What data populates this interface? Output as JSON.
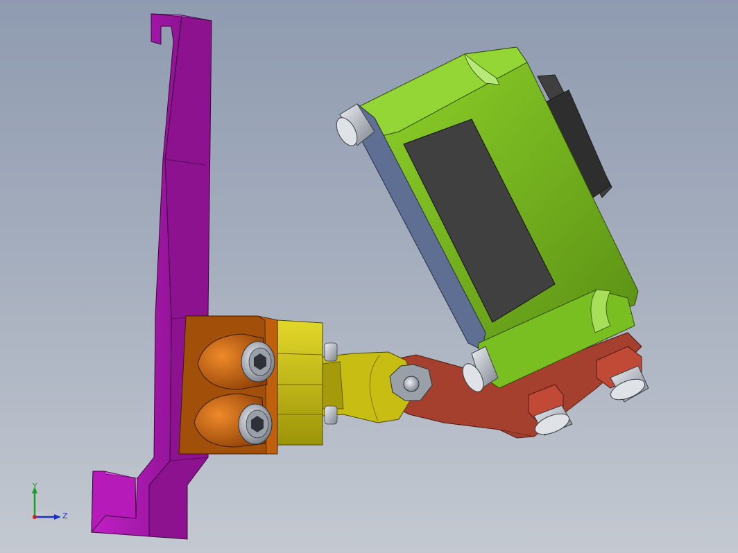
{
  "viewport": {
    "background_top": "#8f9bb0",
    "background_bottom": "#c4c9d1"
  },
  "parts": {
    "bracket_color": "#a418a8",
    "mount_block_color": "#a24f0a",
    "clamp_color": "#c2b80b",
    "link_arm_color": "#a5402f",
    "sensor_body_color": "#6fa418",
    "sensor_face_color": "#5f6f93",
    "sensor_window_color": "#3c3c3c"
  },
  "triad": {
    "y_label": "Y",
    "z_label": "Z",
    "y_color": "#1a9e2a",
    "z_color": "#1a2ec8",
    "origin_color": "#cc2222"
  }
}
